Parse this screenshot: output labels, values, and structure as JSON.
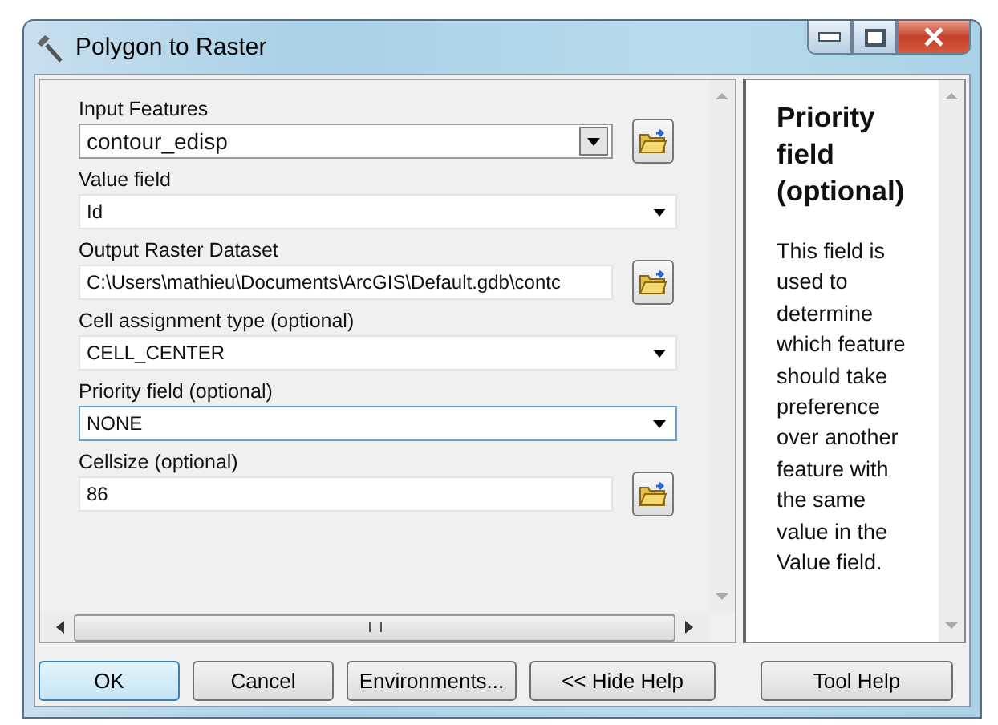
{
  "window": {
    "title": "Polygon to Raster"
  },
  "parameters": [
    {
      "label": "Input Features",
      "value": "contour_edisp",
      "kind": "combo",
      "browse": true,
      "focused": false
    },
    {
      "label": "Value field",
      "value": "Id",
      "kind": "dropdown",
      "browse": false,
      "focused": false
    },
    {
      "label": "Output Raster Dataset",
      "value": "C:\\Users\\mathieu\\Documents\\ArcGIS\\Default.gdb\\contc",
      "kind": "text",
      "browse": true,
      "focused": false
    },
    {
      "label": "Cell assignment type (optional)",
      "value": "CELL_CENTER",
      "kind": "dropdown",
      "browse": false,
      "focused": false
    },
    {
      "label": "Priority field (optional)",
      "value": "NONE",
      "kind": "dropdown",
      "browse": false,
      "focused": true
    },
    {
      "label": "Cellsize (optional)",
      "value": "86",
      "kind": "text",
      "browse": true,
      "focused": false
    }
  ],
  "help": {
    "title": "Priority field (optional)",
    "body": "This field is used to determine which feature should take preference over another feature with the same value in the Value field."
  },
  "buttons": [
    {
      "label": "OK",
      "default": true
    },
    {
      "label": "Cancel",
      "default": false
    },
    {
      "label": "Environments...",
      "default": false
    },
    {
      "label": "<< Hide Help",
      "default": false
    },
    {
      "label": "Tool Help",
      "default": false
    }
  ]
}
